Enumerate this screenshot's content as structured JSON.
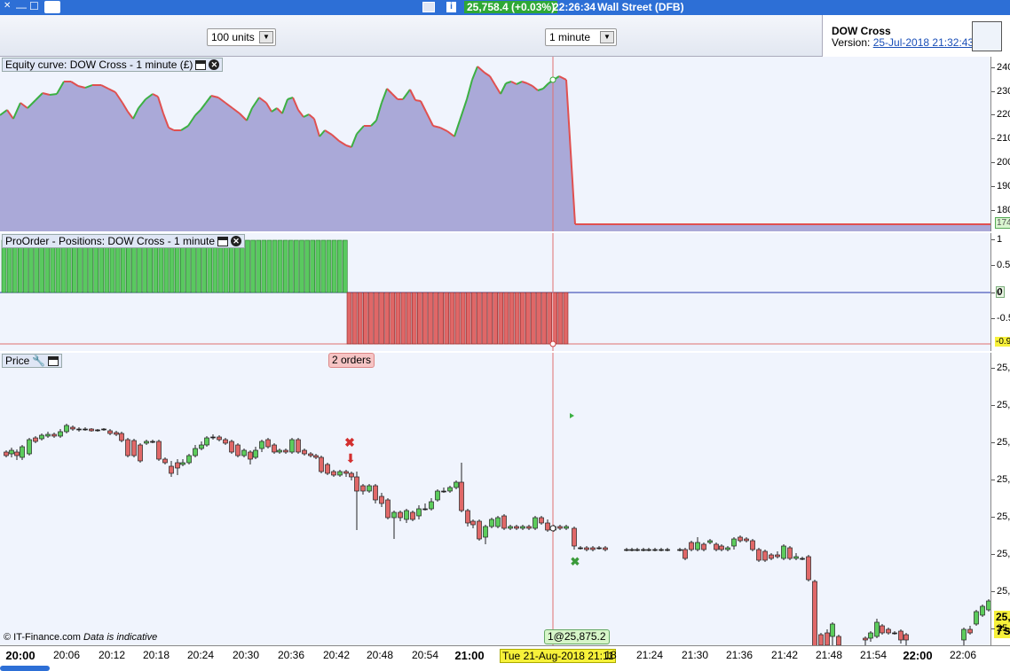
{
  "topbar": {
    "price": "25,758.4 (+0.03%)",
    "time": "22:26:34",
    "instrument": "Wall Street (DFB)"
  },
  "toolbar": {
    "units_value": "100 units",
    "timeframe_value": "1 minute"
  },
  "strategy": {
    "name": "DOW Cross",
    "version_label": "Version:",
    "version_link": "25-Jul-2018 21:32:43"
  },
  "equity": {
    "title": "Equity curve: DOW Cross - 1 minute (£)",
    "ylabels": [
      "240",
      "230",
      "220",
      "210",
      "200",
      "190",
      "180"
    ],
    "last_tag": "174"
  },
  "positions": {
    "title": "ProOrder - Positions: DOW Cross - 1 minute",
    "ylabels": [
      "1",
      "0.5",
      "0",
      "-0.5"
    ],
    "zero_tag": "0",
    "last_tag": "-0.9"
  },
  "price": {
    "title": "Price",
    "orders_badge": "2 orders",
    "ylabels": [
      "25,",
      "25,",
      "25,",
      "25,",
      "25,",
      "25,",
      "25,",
      "25,"
    ],
    "tag_value": "25,",
    "tag_countdown": "7s"
  },
  "watermark": {
    "copyright": "© IT-Finance.com",
    "disclaimer": "Data is indicative"
  },
  "cursor": {
    "date_label": "Tue 21-Aug-2018 21:11",
    "position_label": "1@25,875.2"
  },
  "xaxis": [
    {
      "label": "20:00",
      "major": true
    },
    {
      "label": "20:06"
    },
    {
      "label": "20:12"
    },
    {
      "label": "20:18"
    },
    {
      "label": "20:24"
    },
    {
      "label": "20:30"
    },
    {
      "label": "20:36"
    },
    {
      "label": "20:42"
    },
    {
      "label": "20:48"
    },
    {
      "label": "20:54"
    },
    {
      "label": "21:00",
      "major": true
    },
    {
      "label": "18"
    },
    {
      "label": "21:24"
    },
    {
      "label": "21:30"
    },
    {
      "label": "21:36"
    },
    {
      "label": "21:42"
    },
    {
      "label": "21:48"
    },
    {
      "label": "21:54"
    },
    {
      "label": "22:00",
      "major": true
    },
    {
      "label": "22:06"
    }
  ],
  "colors": {
    "up": "#3cb043",
    "down": "#e05050",
    "equity_fill": "#aaa9d8",
    "accent": "#2d6fd6",
    "cursor": "#e07070",
    "badge_green": "#8ee04a"
  }
}
